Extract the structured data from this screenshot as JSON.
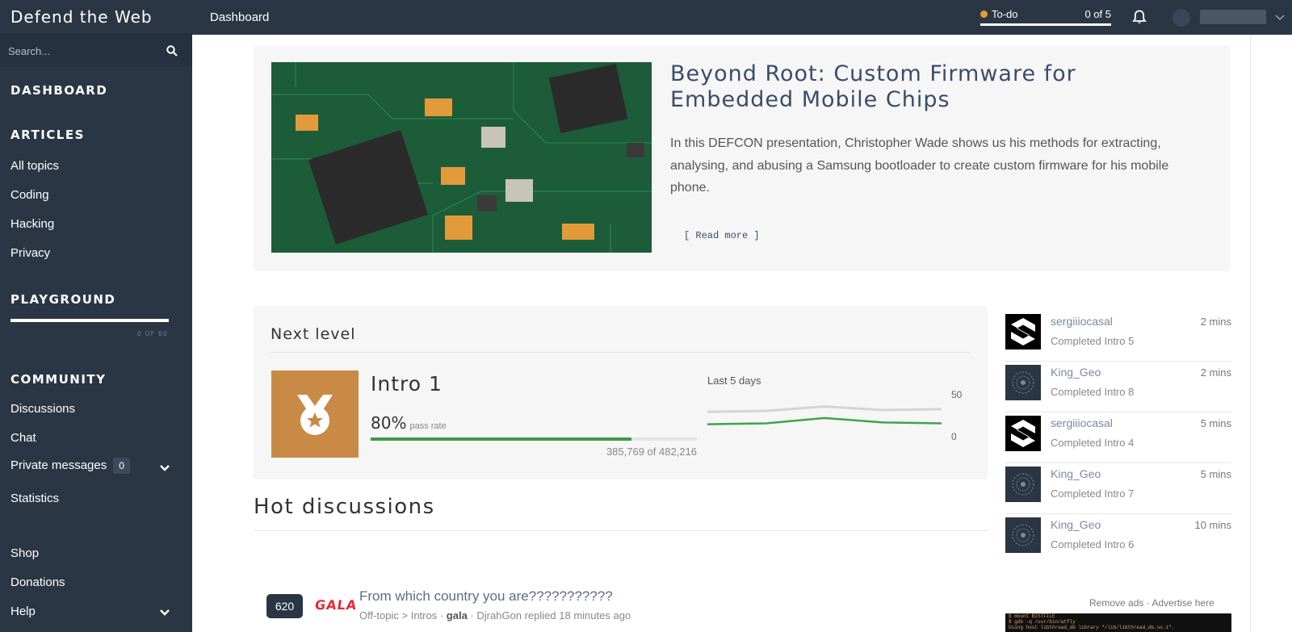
{
  "brand": "Defend the Web",
  "search": {
    "placeholder": "Search..."
  },
  "sidebar": {
    "dashboard": "DASHBOARD",
    "articles": {
      "heading": "ARTICLES",
      "items": [
        "All topics",
        "Coding",
        "Hacking",
        "Privacy"
      ]
    },
    "playground": {
      "heading": "PLAYGROUND",
      "progress_text": "0 OF 60"
    },
    "community": {
      "heading": "COMMUNITY",
      "discussions": "Discussions",
      "chat": "Chat",
      "private_messages": "Private messages",
      "pm_count": "0",
      "statistics": "Statistics"
    },
    "shop": "Shop",
    "donations": "Donations",
    "help": "Help"
  },
  "topbar": {
    "title": "Dashboard",
    "todo_label": "To-do",
    "todo_count": "0 of 5"
  },
  "feature": {
    "title": "Beyond Root: Custom Firmware for Embedded Mobile Chips",
    "description": "In this DEFCON presentation, Christopher Wade shows us his methods for extracting, analysing, and abusing a Samsung bootloader to create custom firmware for his mobile phone.",
    "read_more": "[ Read more ]"
  },
  "next_level": {
    "heading": "Next level",
    "level_name": "Intro 1",
    "pass_rate": "80%",
    "pass_label": "pass rate",
    "pass_fraction": 0.8,
    "count_text": "385,769 of 482,216",
    "chart_label": "Last 5 days"
  },
  "chart_data": {
    "type": "line",
    "x": [
      1,
      2,
      3,
      4,
      5
    ],
    "ylim": [
      0,
      50
    ],
    "y_ticks": [
      "50",
      "0"
    ],
    "series": [
      {
        "values": [
          28,
          29,
          34,
          30,
          31
        ],
        "color": "#d4d4d4"
      },
      {
        "values": [
          14,
          15,
          21,
          16,
          15
        ],
        "color": "#3fa34d"
      }
    ]
  },
  "hot": {
    "heading": "Hot discussions",
    "discussion": {
      "count": "620",
      "badge": "GALA",
      "title": "From which country you are???????????",
      "category": "Off-topic",
      "subcategory": "Intros",
      "author": "gala",
      "reply": "DjrahGon replied 18 minutes ago"
    }
  },
  "activity": [
    {
      "user": "sergiiiocasal",
      "time": "2 mins",
      "desc": "Completed Intro 5",
      "avatar": "s-logo-icon"
    },
    {
      "user": "King_Geo",
      "time": "2 mins",
      "desc": "Completed Intro 8",
      "avatar": "globe-avatar-icon"
    },
    {
      "user": "sergiiiocasal",
      "time": "5 mins",
      "desc": "Completed Intro 4",
      "avatar": "s-logo-icon"
    },
    {
      "user": "King_Geo",
      "time": "5 mins",
      "desc": "Completed Intro 7",
      "avatar": "globe-avatar-icon"
    },
    {
      "user": "King_Geo",
      "time": "10 mins",
      "desc": "Completed Intro 6",
      "avatar": "globe-avatar-icon"
    }
  ],
  "ads": {
    "remove": "Remove ads",
    "advertise": "Advertise here"
  }
}
